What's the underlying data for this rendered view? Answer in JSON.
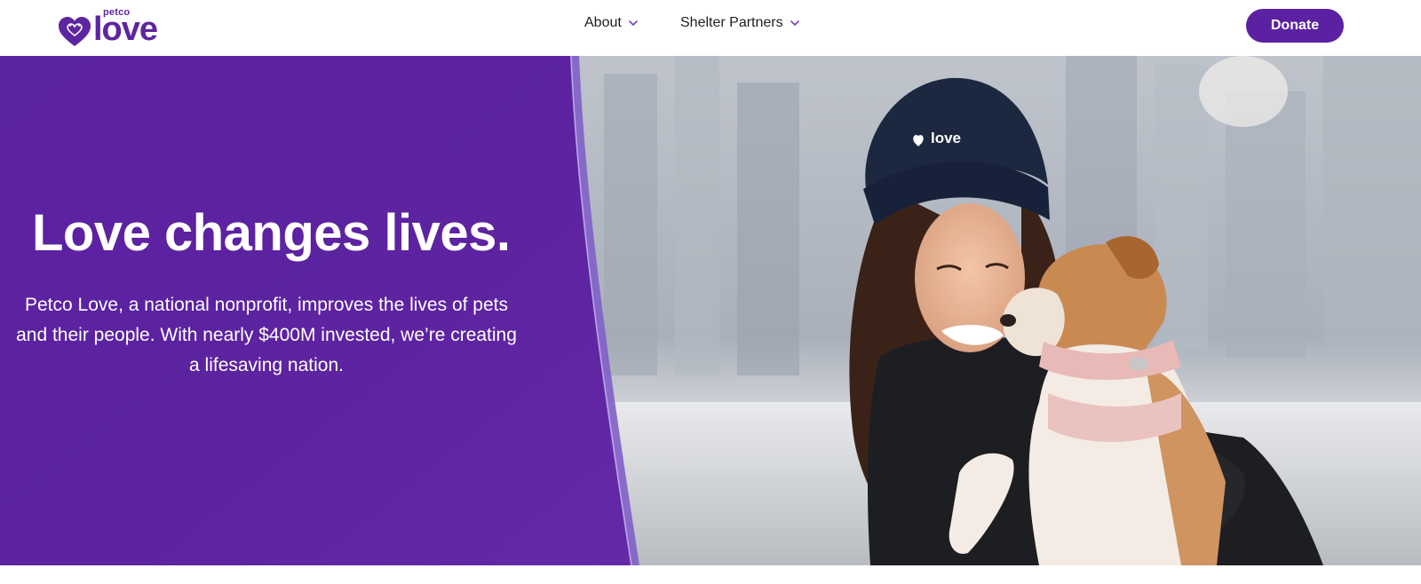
{
  "header": {
    "logo": {
      "small_text": "petco",
      "big_text": "love",
      "brand_color": "#5e25a0"
    },
    "nav": [
      {
        "label": "About",
        "icon": "chevron-down-icon"
      },
      {
        "label": "Shelter Partners",
        "icon": "chevron-down-icon"
      }
    ],
    "donate_label": "Donate",
    "accent_color": "#5b21a2"
  },
  "hero": {
    "headline": "Love changes lives.",
    "subtext": "Petco Love, a national nonprofit, improves the lives of pets and their people. With nearly $400M invested, we’re creating a lifesaving nation.",
    "panel_color": "#5d23a0",
    "photo": {
      "hat_text": "love",
      "subject": "woman in beanie holding a dog"
    }
  }
}
